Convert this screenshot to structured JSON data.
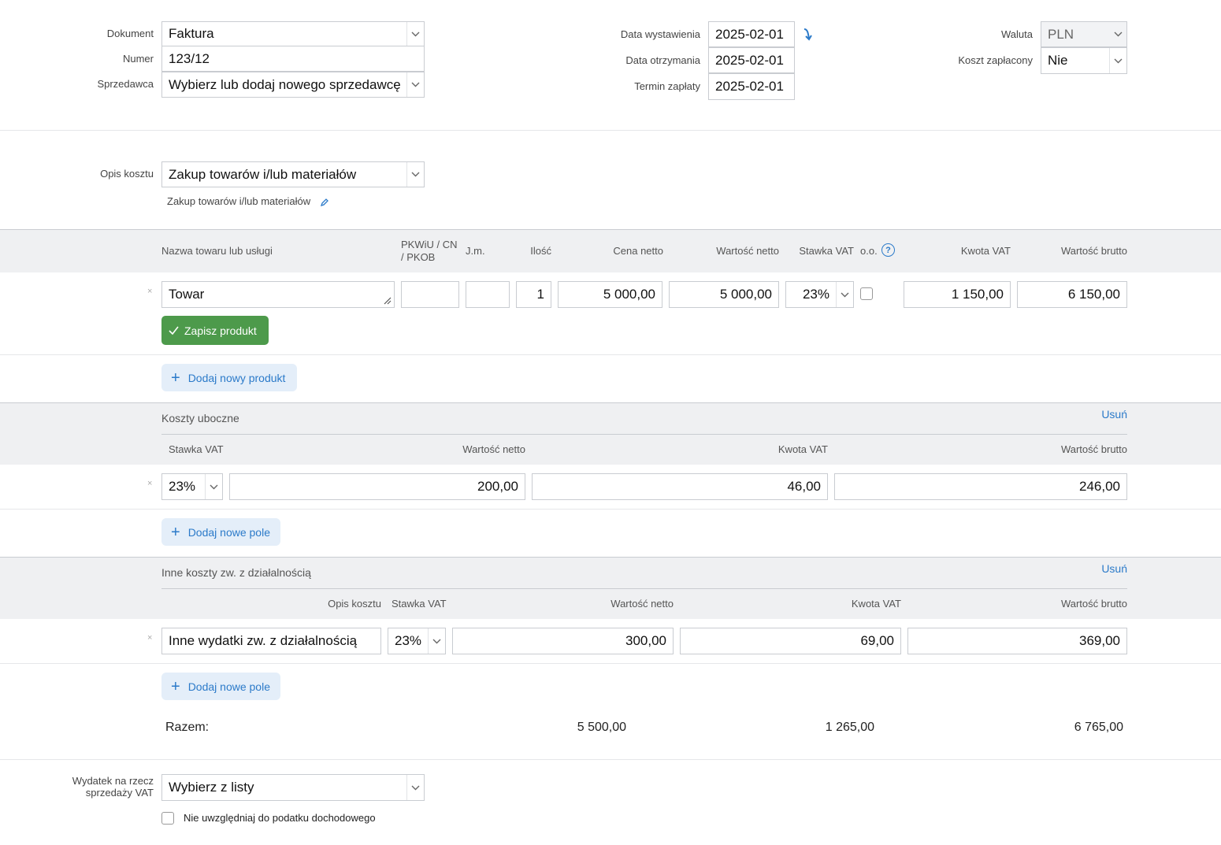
{
  "header": {
    "dokument_label": "Dokument",
    "dokument_value": "Faktura",
    "numer_label": "Numer",
    "numer_value": "123/12",
    "sprzedawca_label": "Sprzedawca",
    "sprzedawca_value": "Wybierz lub dodaj nowego sprzedawcę",
    "data_wystawienia_label": "Data wystawienia",
    "data_wystawienia_value": "2025-02-01",
    "data_otrzymania_label": "Data otrzymania",
    "data_otrzymania_value": "2025-02-01",
    "termin_zaplaty_label": "Termin zapłaty",
    "termin_zaplaty_value": "2025-02-01",
    "waluta_label": "Waluta",
    "waluta_value": "PLN",
    "koszt_zaplacony_label": "Koszt zapłacony",
    "koszt_zaplacony_value": "Nie"
  },
  "opis": {
    "label": "Opis kosztu",
    "value": "Zakup towarów i/lub materiałów",
    "subtext": "Zakup towarów i/lub materiałów"
  },
  "products": {
    "columns": {
      "name": "Nazwa towaru lub usługi",
      "pkwiu": "PKWiU / CN / PKOB",
      "jm": "J.m.",
      "qty": "Ilość",
      "price": "Cena netto",
      "net": "Wartość netto",
      "vat_rate": "Stawka VAT",
      "oo": "o.o.",
      "vat_amount": "Kwota VAT",
      "gross": "Wartość brutto"
    },
    "row": {
      "remove": "×",
      "name": "Towar",
      "pkwiu": "",
      "jm": "",
      "qty": "1",
      "price": "5 000,00",
      "net": "5 000,00",
      "vat_rate": "23%",
      "vat_amount": "1 150,00",
      "gross": "6 150,00"
    },
    "save_label": "Zapisz produkt",
    "add_label": "Dodaj nowy produkt"
  },
  "koszty_uboczne": {
    "title": "Koszty uboczne",
    "remove_label": "Usuń",
    "columns": {
      "vat_rate": "Stawka VAT",
      "net": "Wartość netto",
      "vat_amount": "Kwota VAT",
      "gross": "Wartość brutto"
    },
    "row": {
      "remove": "×",
      "vat_rate": "23%",
      "net": "200,00",
      "vat_amount": "46,00",
      "gross": "246,00"
    },
    "add_label": "Dodaj nowe pole"
  },
  "inne_koszty": {
    "title": "Inne koszty zw. z działalnością",
    "remove_label": "Usuń",
    "columns": {
      "opis": "Opis kosztu",
      "vat_rate": "Stawka VAT",
      "net": "Wartość netto",
      "vat_amount": "Kwota VAT",
      "gross": "Wartość brutto"
    },
    "row": {
      "remove": "×",
      "opis": "Inne wydatki zw. z działalnością",
      "vat_rate": "23%",
      "net": "300,00",
      "vat_amount": "69,00",
      "gross": "369,00"
    },
    "add_label": "Dodaj nowe pole"
  },
  "totals": {
    "label": "Razem:",
    "net": "5 500,00",
    "vat": "1 265,00",
    "gross": "6 765,00"
  },
  "footer": {
    "wydatek_label_line1": "Wydatek na rzecz",
    "wydatek_label_line2": "sprzedaży VAT",
    "wydatek_value": "Wybierz z listy",
    "checkbox_label": "Nie uwzględniaj do podatku dochodowego"
  },
  "colors": {
    "accent": "#2b7ac9",
    "save_button": "#4d9a4b",
    "band": "#eff0f2"
  }
}
